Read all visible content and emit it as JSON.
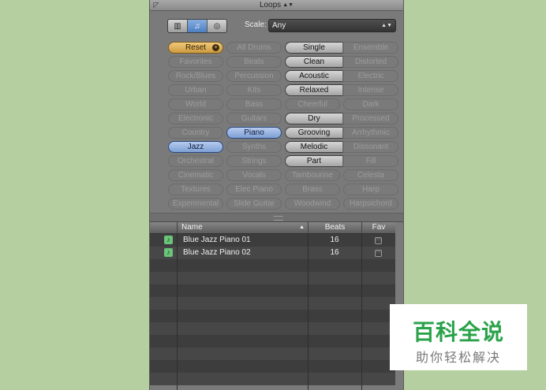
{
  "window": {
    "title": "Loops"
  },
  "toolbar": {
    "view_buttons": [
      {
        "icon": "column-view-icon",
        "glyph": "▥",
        "active": false
      },
      {
        "icon": "music-note-icon",
        "glyph": "♫",
        "active": true
      },
      {
        "icon": "podcast-icon",
        "glyph": "◎",
        "active": false
      }
    ],
    "scale_label": "Scale:",
    "scale_value": "Any"
  },
  "keywords": [
    [
      {
        "label": "Reset",
        "state": "reset"
      },
      {
        "label": "All Drums",
        "state": "dim"
      },
      {
        "label": "Single",
        "state": "on"
      },
      {
        "label": "Ensemble",
        "state": "dim"
      }
    ],
    [
      {
        "label": "Favorites",
        "state": "dim"
      },
      {
        "label": "Beats",
        "state": "dim"
      },
      {
        "label": "Clean",
        "state": "on"
      },
      {
        "label": "Distorted",
        "state": "dim"
      }
    ],
    [
      {
        "label": "Rock/Blues",
        "state": "dim"
      },
      {
        "label": "Percussion",
        "state": "dim"
      },
      {
        "label": "Acoustic",
        "state": "on"
      },
      {
        "label": "Electric",
        "state": "dim"
      }
    ],
    [
      {
        "label": "Urban",
        "state": "dim"
      },
      {
        "label": "Kits",
        "state": "dim"
      },
      {
        "label": "Relaxed",
        "state": "on"
      },
      {
        "label": "Intense",
        "state": "dim"
      }
    ],
    [
      {
        "label": "World",
        "state": "dim"
      },
      {
        "label": "Bass",
        "state": "dim"
      },
      {
        "label": "Cheerful",
        "state": "dim"
      },
      {
        "label": "Dark",
        "state": "dim"
      }
    ],
    [
      {
        "label": "Electronic",
        "state": "dim"
      },
      {
        "label": "Guitars",
        "state": "dim"
      },
      {
        "label": "Dry",
        "state": "on"
      },
      {
        "label": "Processed",
        "state": "dim"
      }
    ],
    [
      {
        "label": "Country",
        "state": "dim"
      },
      {
        "label": "Piano",
        "state": "sel"
      },
      {
        "label": "Grooving",
        "state": "on"
      },
      {
        "label": "Arrhythmic",
        "state": "dim"
      }
    ],
    [
      {
        "label": "Jazz",
        "state": "sel"
      },
      {
        "label": "Synths",
        "state": "dim"
      },
      {
        "label": "Melodic",
        "state": "on"
      },
      {
        "label": "Dissonant",
        "state": "dim"
      }
    ],
    [
      {
        "label": "Orchestral",
        "state": "dim"
      },
      {
        "label": "Strings",
        "state": "dim"
      },
      {
        "label": "Part",
        "state": "on"
      },
      {
        "label": "Fill",
        "state": "dim"
      }
    ],
    [
      {
        "label": "Cinematic",
        "state": "dim"
      },
      {
        "label": "Vocals",
        "state": "dim"
      },
      {
        "label": "Tambourine",
        "state": "dim"
      },
      {
        "label": "Celesta",
        "state": "dim"
      }
    ],
    [
      {
        "label": "Textures",
        "state": "dim"
      },
      {
        "label": "Elec Piano",
        "state": "dim"
      },
      {
        "label": "Brass",
        "state": "dim"
      },
      {
        "label": "Harp",
        "state": "dim"
      }
    ],
    [
      {
        "label": "Experimental",
        "state": "dim"
      },
      {
        "label": "Slide Guitar",
        "state": "dim"
      },
      {
        "label": "Woodwind",
        "state": "dim"
      },
      {
        "label": "Harpsichord",
        "state": "dim"
      }
    ]
  ],
  "table": {
    "columns": {
      "name": "Name",
      "beats": "Beats",
      "fav": "Fav"
    },
    "rows": [
      {
        "name": "Blue Jazz Piano 01",
        "beats": "16",
        "fav": false
      },
      {
        "name": "Blue Jazz Piano 02",
        "beats": "16",
        "fav": false
      }
    ],
    "empty_rows": 10
  },
  "watermark": {
    "top": "百科全说",
    "bottom": "助你轻松解决"
  }
}
